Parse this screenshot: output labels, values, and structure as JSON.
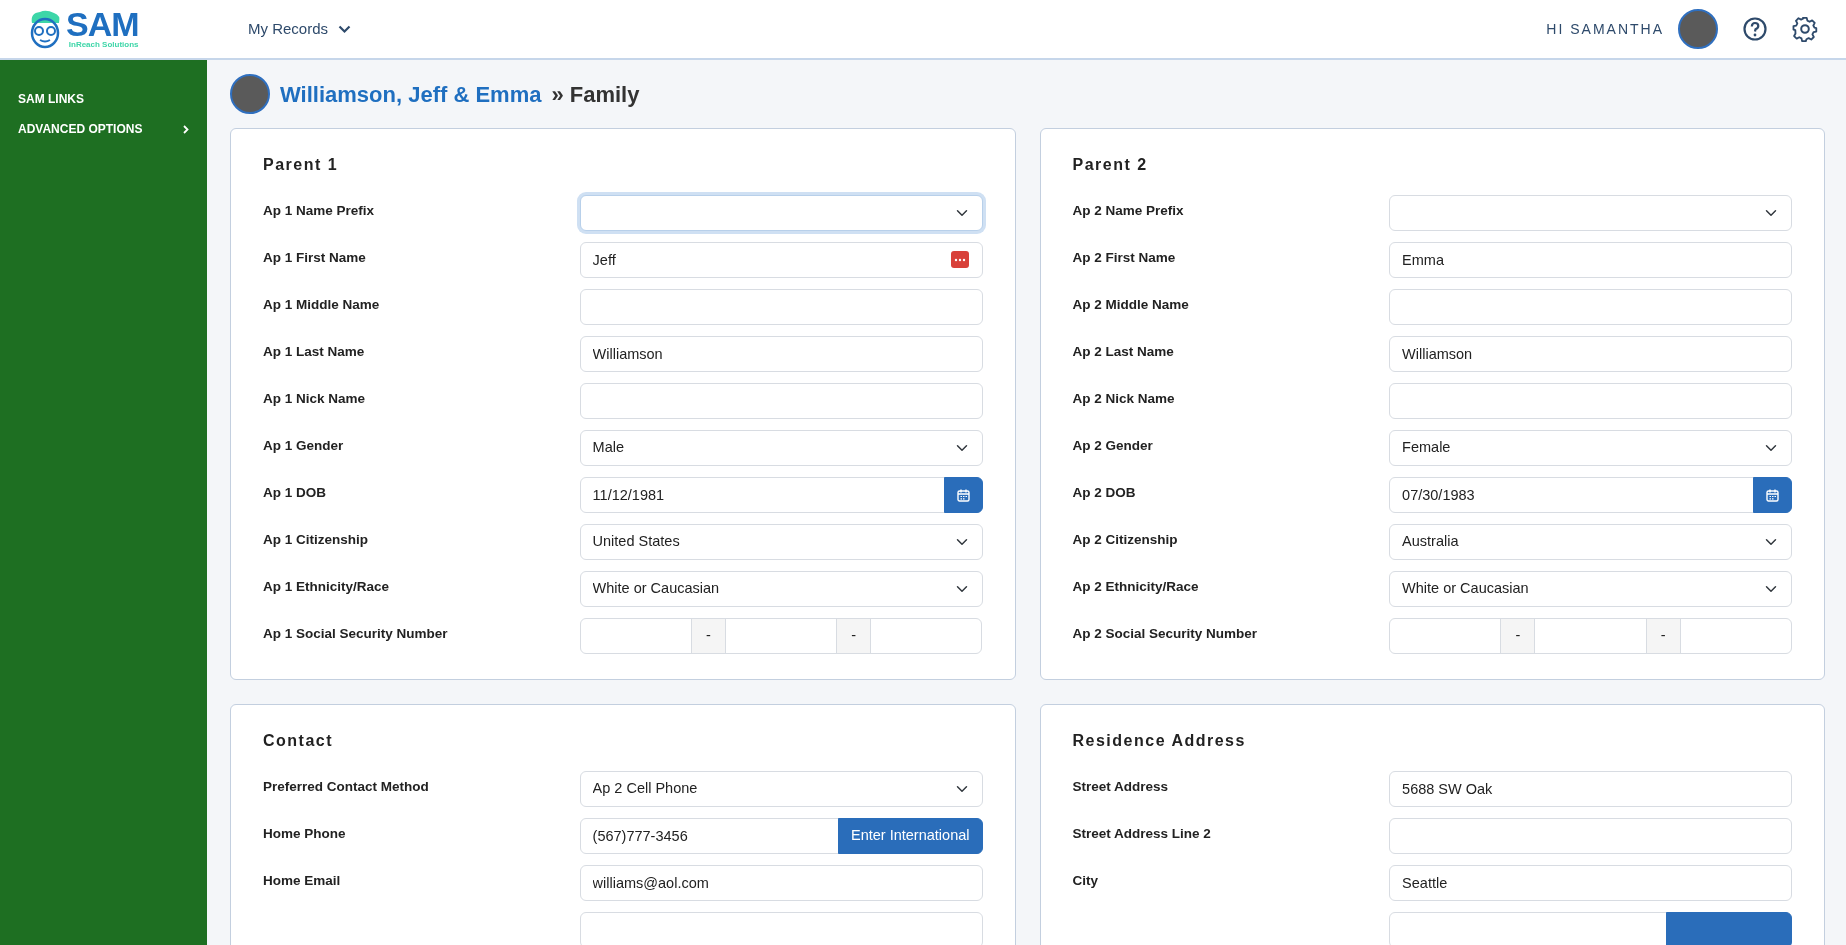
{
  "header": {
    "logo": {
      "title": "SAM",
      "subtitle": "InReach Solutions"
    },
    "nav": {
      "label": "My Records"
    },
    "greeting": "HI SAMANTHA"
  },
  "sidebar": {
    "items": [
      {
        "label": "SAM LINKS",
        "expandable": false
      },
      {
        "label": "ADVANCED OPTIONS",
        "expandable": true
      }
    ]
  },
  "breadcrumb": {
    "link": "Williamson, Jeff & Emma",
    "separator": "»",
    "current": "Family"
  },
  "cards": [
    {
      "title": "Parent 1",
      "fields": [
        {
          "label": "Ap 1 Name Prefix",
          "kind": "select",
          "focused": true
        },
        {
          "label": "Ap 1 First Name",
          "kind": "password-text",
          "value": "Jeff",
          "focused": false
        },
        {
          "label": "Ap 1 Middle Name",
          "kind": "text",
          "focused": false
        },
        {
          "label": "Ap 1 Last Name",
          "kind": "text",
          "value": "Williamson",
          "focused": false
        },
        {
          "label": "Ap 1 Nick Name",
          "kind": "text",
          "focused": false
        },
        {
          "label": "Ap 1 Gender",
          "kind": "select",
          "value": "Male",
          "focused": false
        },
        {
          "label": "Ap 1 DOB",
          "kind": "date",
          "value": "11/12/1981",
          "focused": false
        },
        {
          "label": "Ap 1 Citizenship",
          "kind": "select",
          "value": "United States",
          "focused": false
        },
        {
          "label": "Ap 1 Ethnicity/Race",
          "kind": "select",
          "value": "White or Caucasian",
          "focused": false
        },
        {
          "label": "Ap 1 Social Security Number",
          "kind": "ssn",
          "separators": [
            "-",
            "-"
          ],
          "focused": false
        }
      ]
    },
    {
      "title": "Parent 2",
      "fields": [
        {
          "label": "Ap 2 Name Prefix",
          "kind": "select",
          "focused": false
        },
        {
          "label": "Ap 2 First Name",
          "kind": "text",
          "value": "Emma",
          "focused": false
        },
        {
          "label": "Ap 2 Middle Name",
          "kind": "text",
          "focused": false
        },
        {
          "label": "Ap 2 Last Name",
          "kind": "text",
          "value": "Williamson",
          "focused": false
        },
        {
          "label": "Ap 2 Nick Name",
          "kind": "text",
          "focused": false
        },
        {
          "label": "Ap 2 Gender",
          "kind": "select",
          "value": "Female",
          "focused": false
        },
        {
          "label": "Ap 2 DOB",
          "kind": "date",
          "value": "07/30/1983",
          "focused": false
        },
        {
          "label": "Ap 2 Citizenship",
          "kind": "select",
          "value": "Australia",
          "focused": false
        },
        {
          "label": "Ap 2 Ethnicity/Race",
          "kind": "select",
          "value": "White or Caucasian",
          "focused": false
        },
        {
          "label": "Ap 2 Social Security Number",
          "kind": "ssn",
          "separators": [
            "-",
            "-"
          ],
          "focused": false
        }
      ]
    },
    {
      "title": "Contact",
      "fields": [
        {
          "label": "Preferred Contact Method",
          "kind": "select",
          "value": "Ap 2 Cell Phone",
          "focused": false
        },
        {
          "label": "Home Phone",
          "kind": "text-button",
          "value": "(567)777-3456",
          "button": "Enter International",
          "focused": false
        },
        {
          "label": "Home Email",
          "kind": "text",
          "value": "williams@aol.com",
          "focused": false
        },
        {
          "kind": "text",
          "focused": false
        }
      ]
    },
    {
      "title": "Residence Address",
      "fields": [
        {
          "label": "Street Address",
          "kind": "text",
          "value": "5688 SW Oak",
          "focused": false
        },
        {
          "label": "Street Address Line 2",
          "kind": "text",
          "focused": false
        },
        {
          "label": "City",
          "kind": "text",
          "value": "Seattle",
          "focused": false
        },
        {
          "kind": "text-button",
          "focused": false
        }
      ]
    }
  ]
}
